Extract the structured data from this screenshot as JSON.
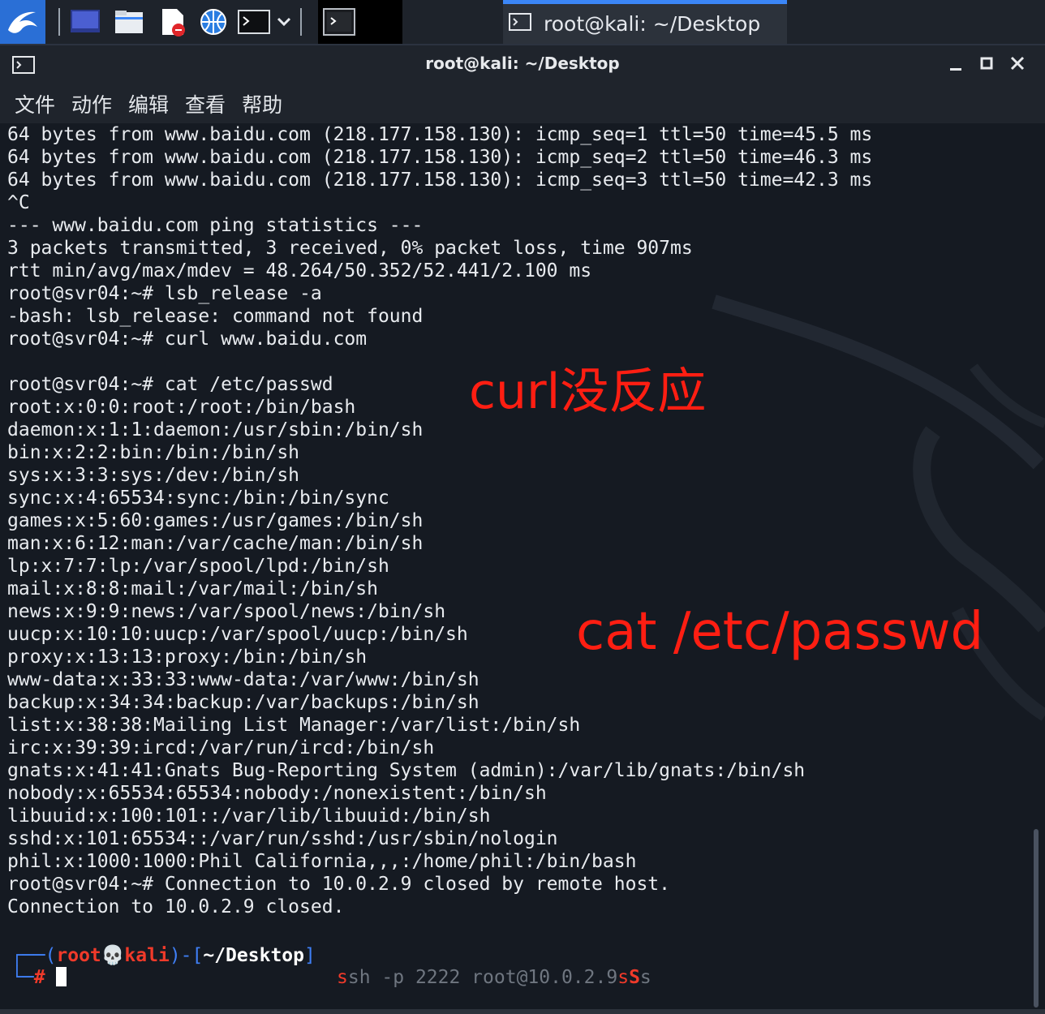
{
  "taskbar": {
    "icons": [
      "kali-menu-icon",
      "desktop-icon",
      "file-manager-icon",
      "text-editor-icon",
      "web-browser-icon",
      "terminal-icon",
      "dropdown-icon",
      "terminal-active-icon"
    ],
    "task_title": "root@kali: ~/Desktop"
  },
  "window": {
    "title": "root@kali: ~/Desktop",
    "controls": {
      "minimize": "–",
      "maximize": "□",
      "close": "✕"
    }
  },
  "menu": [
    "文件",
    "动作",
    "编辑",
    "查看",
    "帮助"
  ],
  "terminal": {
    "lines": [
      "64 bytes from www.baidu.com (218.177.158.130): icmp_seq=1 ttl=50 time=45.5 ms",
      "64 bytes from www.baidu.com (218.177.158.130): icmp_seq=2 ttl=50 time=46.3 ms",
      "64 bytes from www.baidu.com (218.177.158.130): icmp_seq=3 ttl=50 time=42.3 ms",
      "^C",
      "--- www.baidu.com ping statistics ---",
      "3 packets transmitted, 3 received, 0% packet loss, time 907ms",
      "rtt min/avg/max/mdev = 48.264/50.352/52.441/2.100 ms",
      "root@svr04:~# lsb_release -a",
      "-bash: lsb_release: command not found",
      "root@svr04:~# curl www.baidu.com",
      "",
      "root@svr04:~# cat /etc/passwd",
      "root:x:0:0:root:/root:/bin/bash",
      "daemon:x:1:1:daemon:/usr/sbin:/bin/sh",
      "bin:x:2:2:bin:/bin:/bin/sh",
      "sys:x:3:3:sys:/dev:/bin/sh",
      "sync:x:4:65534:sync:/bin:/bin/sync",
      "games:x:5:60:games:/usr/games:/bin/sh",
      "man:x:6:12:man:/var/cache/man:/bin/sh",
      "lp:x:7:7:lp:/var/spool/lpd:/bin/sh",
      "mail:x:8:8:mail:/var/mail:/bin/sh",
      "news:x:9:9:news:/var/spool/news:/bin/sh",
      "uucp:x:10:10:uucp:/var/spool/uucp:/bin/sh",
      "proxy:x:13:13:proxy:/bin:/bin/sh",
      "www-data:x:33:33:www-data:/var/www:/bin/sh",
      "backup:x:34:34:backup:/var/backups:/bin/sh",
      "list:x:38:38:Mailing List Manager:/var/list:/bin/sh",
      "irc:x:39:39:ircd:/var/run/ircd:/bin/sh",
      "gnats:x:41:41:Gnats Bug-Reporting System (admin):/var/lib/gnats:/bin/sh",
      "nobody:x:65534:65534:nobody:/nonexistent:/bin/sh",
      "libuuid:x:100:101::/var/lib/libuuid:/bin/sh",
      "sshd:x:101:65534::/var/run/sshd:/usr/sbin/nologin",
      "phil:x:1000:1000:Phil California,,,:/home/phil:/bin/bash",
      "root@svr04:~# Connection to 10.0.2.9 closed by remote host.",
      "Connection to 10.0.2.9 closed."
    ],
    "prompt": {
      "open": "┌──(",
      "user": "root",
      "skull": "💀",
      "host": "kali",
      "mid": ")-[",
      "cwd": "~/Desktop",
      "close": "]",
      "line2": "└─",
      "hash": "#",
      "suggestion_s": "s",
      "suggestion_rest": "sh -p 2222 root@10.0.2.9",
      "suggestion_tail_s1": "s",
      "suggestion_tail_S": "S",
      "suggestion_tail_s2": "s"
    }
  },
  "annotations": {
    "curl": "curl没反应",
    "cat": "cat /etc/passwd"
  },
  "colors": {
    "annotation": "#ff1e12",
    "prompt_blue": "#3f7ff5",
    "prompt_red": "#f03a2a",
    "task_accent": "#3b86f7"
  }
}
